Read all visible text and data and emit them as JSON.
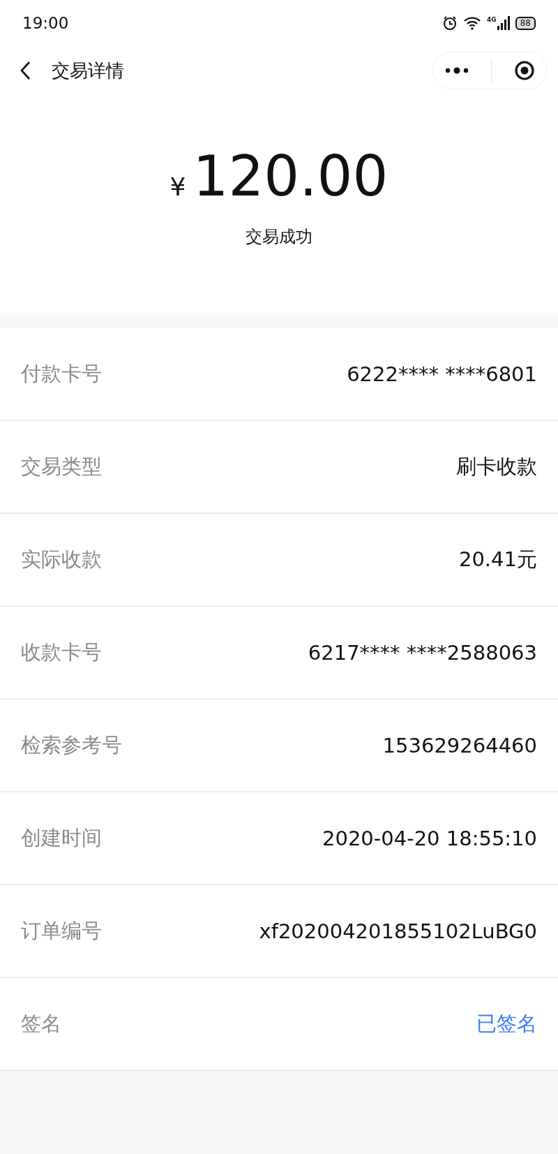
{
  "status_bar": {
    "time": "19:00",
    "network": "4G",
    "battery": "88"
  },
  "nav": {
    "title": "交易详情"
  },
  "amount": {
    "currency": "¥",
    "value": "120.00",
    "status": "交易成功"
  },
  "details": [
    {
      "label": "付款卡号",
      "value": "6222**** ****6801",
      "kind": "text"
    },
    {
      "label": "交易类型",
      "value": "刷卡收款",
      "kind": "text"
    },
    {
      "label": "实际收款",
      "value": "20.41元",
      "kind": "text"
    },
    {
      "label": "收款卡号",
      "value": "6217**** ****2588063",
      "kind": "text"
    },
    {
      "label": "检索参考号",
      "value": "153629264460",
      "kind": "text"
    },
    {
      "label": "创建时间",
      "value": "2020-04-20 18:55:10",
      "kind": "text"
    },
    {
      "label": "订单编号",
      "value": "xf202004201855102LuBG0",
      "kind": "text"
    },
    {
      "label": "签名",
      "value": "已签名",
      "kind": "link"
    }
  ]
}
